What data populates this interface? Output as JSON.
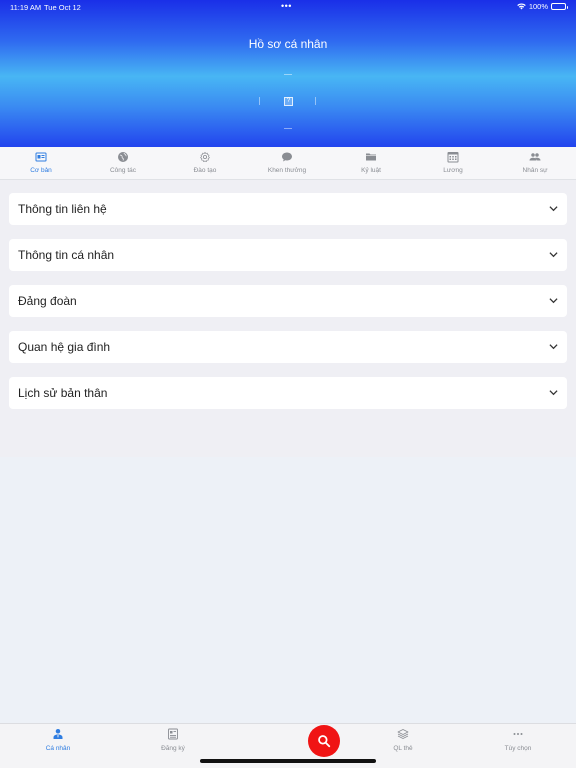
{
  "status_bar": {
    "time": "11:19 AM",
    "date": "Tue Oct 12",
    "dots": "•••",
    "battery": "100%"
  },
  "header": {
    "title": "Hồ sơ cá nhân",
    "avatar_glyph": "?"
  },
  "tabs": [
    {
      "label": "Cơ bản",
      "icon": "id-card-icon",
      "active": true
    },
    {
      "label": "Công tác",
      "icon": "globe-icon",
      "active": false
    },
    {
      "label": "Đào tạo",
      "icon": "gear-icon",
      "active": false
    },
    {
      "label": "Khen thưởng",
      "icon": "chat-bubble-icon",
      "active": false
    },
    {
      "label": "Kỷ luật",
      "icon": "folder-icon",
      "active": false
    },
    {
      "label": "Lương",
      "icon": "calendar-icon",
      "active": false
    },
    {
      "label": "Nhân sự",
      "icon": "people-icon",
      "active": false
    }
  ],
  "sections": [
    {
      "title": "Thông tin liên hệ"
    },
    {
      "title": "Thông tin cá nhân"
    },
    {
      "title": "Đảng đoàn"
    },
    {
      "title": "Quan hệ gia đình"
    },
    {
      "title": "Lịch sử bản thân"
    }
  ],
  "bottom_nav": [
    {
      "label": "Cá nhân",
      "icon": "person-icon",
      "active": true
    },
    {
      "label": "Đăng ký",
      "icon": "register-form-icon",
      "active": false
    },
    {
      "label": "QL thẻ",
      "icon": "layers-icon",
      "active": false
    },
    {
      "label": "Tùy chọn",
      "icon": "more-dots-icon",
      "active": false
    }
  ],
  "colors": {
    "accent": "#2f7de1",
    "search_button": "#f01414",
    "inactive": "#8a8d93"
  }
}
